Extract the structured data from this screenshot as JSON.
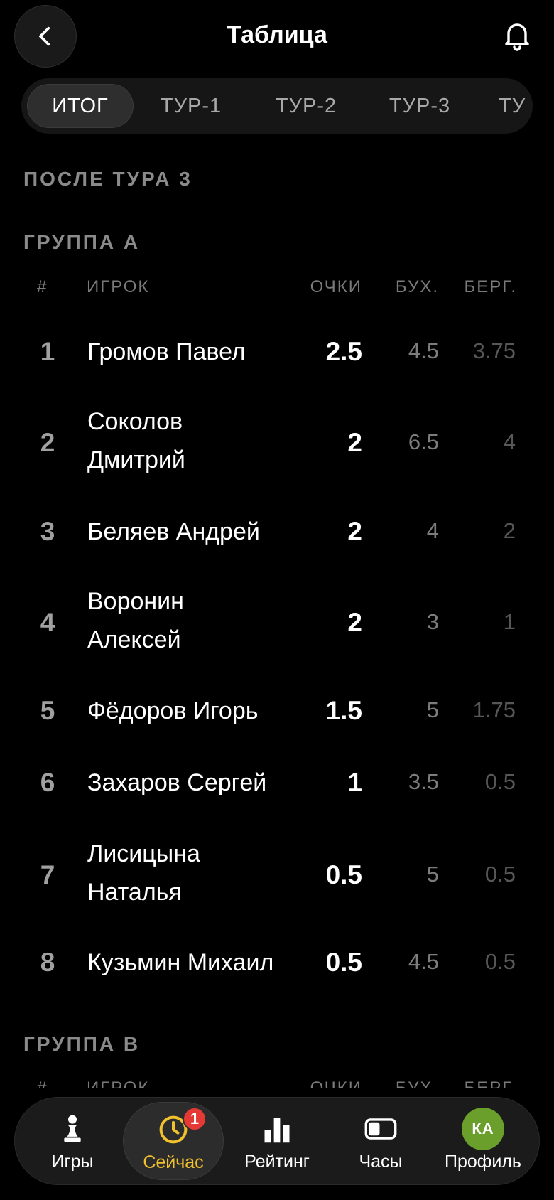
{
  "header": {
    "title": "Таблица"
  },
  "tabs": [
    {
      "label": "ИТОГ",
      "active": true
    },
    {
      "label": "ТУР-1",
      "active": false
    },
    {
      "label": "ТУР-2",
      "active": false
    },
    {
      "label": "ТУР-3",
      "active": false
    },
    {
      "label": "ТУ",
      "active": false
    }
  ],
  "section": {
    "title": "ПОСЛЕ ТУРА 3"
  },
  "columns": {
    "rank": "#",
    "player": "ИГРОК",
    "points": "ОЧКИ",
    "buchholz": "БУХ.",
    "berger": "БЕРГ."
  },
  "group_a": {
    "title": "ГРУППА А",
    "rows": [
      {
        "rank": "1",
        "name": "Громов Павел",
        "points": "2.5",
        "buchholz": "4.5",
        "berger": "3.75"
      },
      {
        "rank": "2",
        "name": "Соколов Дмитрий",
        "points": "2",
        "buchholz": "6.5",
        "berger": "4"
      },
      {
        "rank": "3",
        "name": "Беляев Андрей",
        "points": "2",
        "buchholz": "4",
        "berger": "2"
      },
      {
        "rank": "4",
        "name": "Воронин Алексей",
        "points": "2",
        "buchholz": "3",
        "berger": "1"
      },
      {
        "rank": "5",
        "name": "Фёдоров Игорь",
        "points": "1.5",
        "buchholz": "5",
        "berger": "1.75"
      },
      {
        "rank": "6",
        "name": "Захаров Сергей",
        "points": "1",
        "buchholz": "3.5",
        "berger": "0.5"
      },
      {
        "rank": "7",
        "name": "Лисицына Наталья",
        "points": "0.5",
        "buchholz": "5",
        "berger": "0.5"
      },
      {
        "rank": "8",
        "name": "Кузьмин Михаил",
        "points": "0.5",
        "buchholz": "4.5",
        "berger": "0.5"
      }
    ]
  },
  "group_b": {
    "title": "ГРУППА В"
  },
  "nav": {
    "items": [
      {
        "label": "Игры",
        "icon": "pawn-icon"
      },
      {
        "label": "Сейчас",
        "icon": "clock-icon",
        "badge": "1",
        "active": true
      },
      {
        "label": "Рейтинг",
        "icon": "bar-chart-icon"
      },
      {
        "label": "Часы",
        "icon": "chess-clock-icon"
      },
      {
        "label": "Профиль",
        "icon": "avatar",
        "avatar_initials": "КА"
      }
    ]
  },
  "colors": {
    "accent": "#f2c12e",
    "badge": "#e53935",
    "avatar": "#6a9f2c",
    "background": "#000000"
  }
}
